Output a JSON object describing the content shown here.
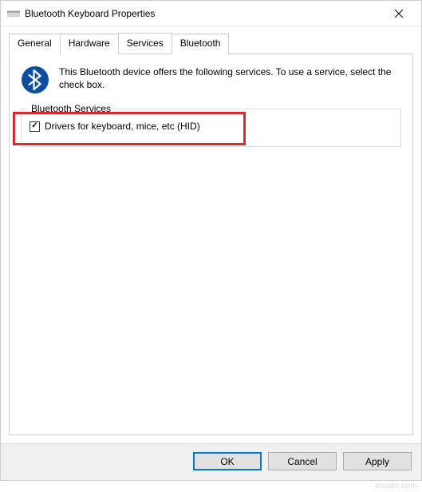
{
  "window": {
    "title": "Bluetooth Keyboard Properties"
  },
  "tabs": {
    "general": "General",
    "hardware": "Hardware",
    "services": "Services",
    "bluetooth": "Bluetooth"
  },
  "panel": {
    "info_text": "This Bluetooth device offers the following services. To use a service, select the check box.",
    "group_label": "Bluetooth Services",
    "checkbox_label": "Drivers for keyboard, mice, etc (HID)"
  },
  "buttons": {
    "ok": "OK",
    "cancel": "Cancel",
    "apply": "Apply"
  },
  "watermark": "wsxdn.com"
}
